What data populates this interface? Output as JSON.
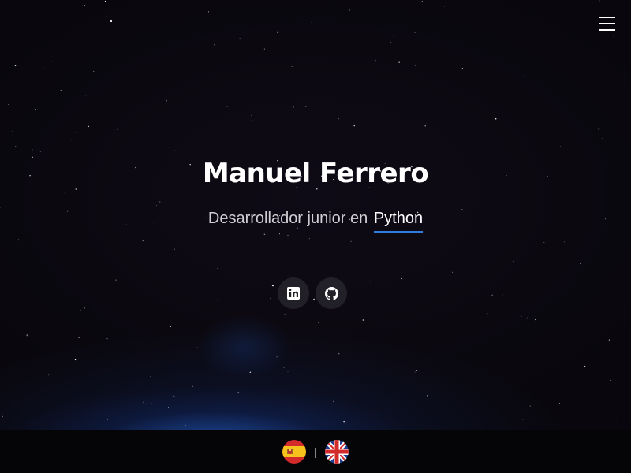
{
  "nav": {
    "menu_icon": "hamburger-menu-icon"
  },
  "hero": {
    "name": "Manuel Ferrero",
    "subtitle_prefix": "Desarrollador junior en",
    "subtitle_highlight": "Python",
    "accent_color": "#2f7de1",
    "background_color": "#0b0810"
  },
  "socials": [
    {
      "name": "linkedin",
      "icon": "linkedin-icon"
    },
    {
      "name": "github",
      "icon": "github-icon"
    }
  ],
  "footer": {
    "separator": "|",
    "languages": [
      {
        "code": "es",
        "icon": "spain-flag-icon"
      },
      {
        "code": "en",
        "icon": "uk-flag-icon"
      }
    ]
  }
}
